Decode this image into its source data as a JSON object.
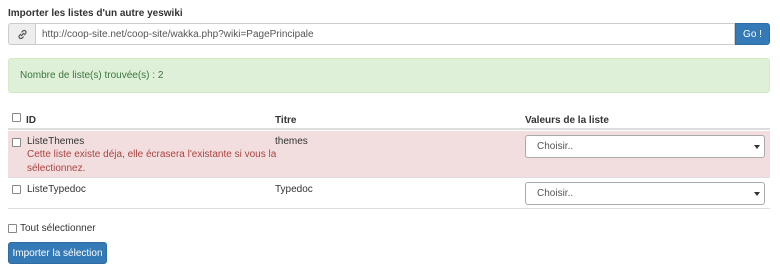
{
  "heading": "Importer les listes d'un autre yeswiki",
  "url_field": {
    "icon": "link-icon",
    "value": "http://coop-site.net/coop-site/wakka.php?wiki=PagePrincipale"
  },
  "go_label": "Go !",
  "alert_text": "Nombre de liste(s) trouvée(s) : 2",
  "table": {
    "headers": {
      "id": "ID",
      "title": "Titre",
      "values": "Valeurs de la liste"
    },
    "rows": [
      {
        "id": "ListeThemes",
        "title": "themes",
        "warning_line1": "Cette liste existe déja, elle écrasera l'existante si vous la",
        "warning_line2": "sélectionnez.",
        "select_value": "Choisir..",
        "status": "danger"
      },
      {
        "id": "ListeTypedoc",
        "title": "Typedoc",
        "select_value": "Choisir.."
      }
    ]
  },
  "select_all_label": "Tout sélectionner",
  "import_button_label": "Importer la sélection",
  "colors": {
    "primary": "#337ab7",
    "success_bg": "#dff0d8",
    "success_text": "#3c763d",
    "danger_bg": "#f2dede",
    "danger_text": "#a94442"
  }
}
